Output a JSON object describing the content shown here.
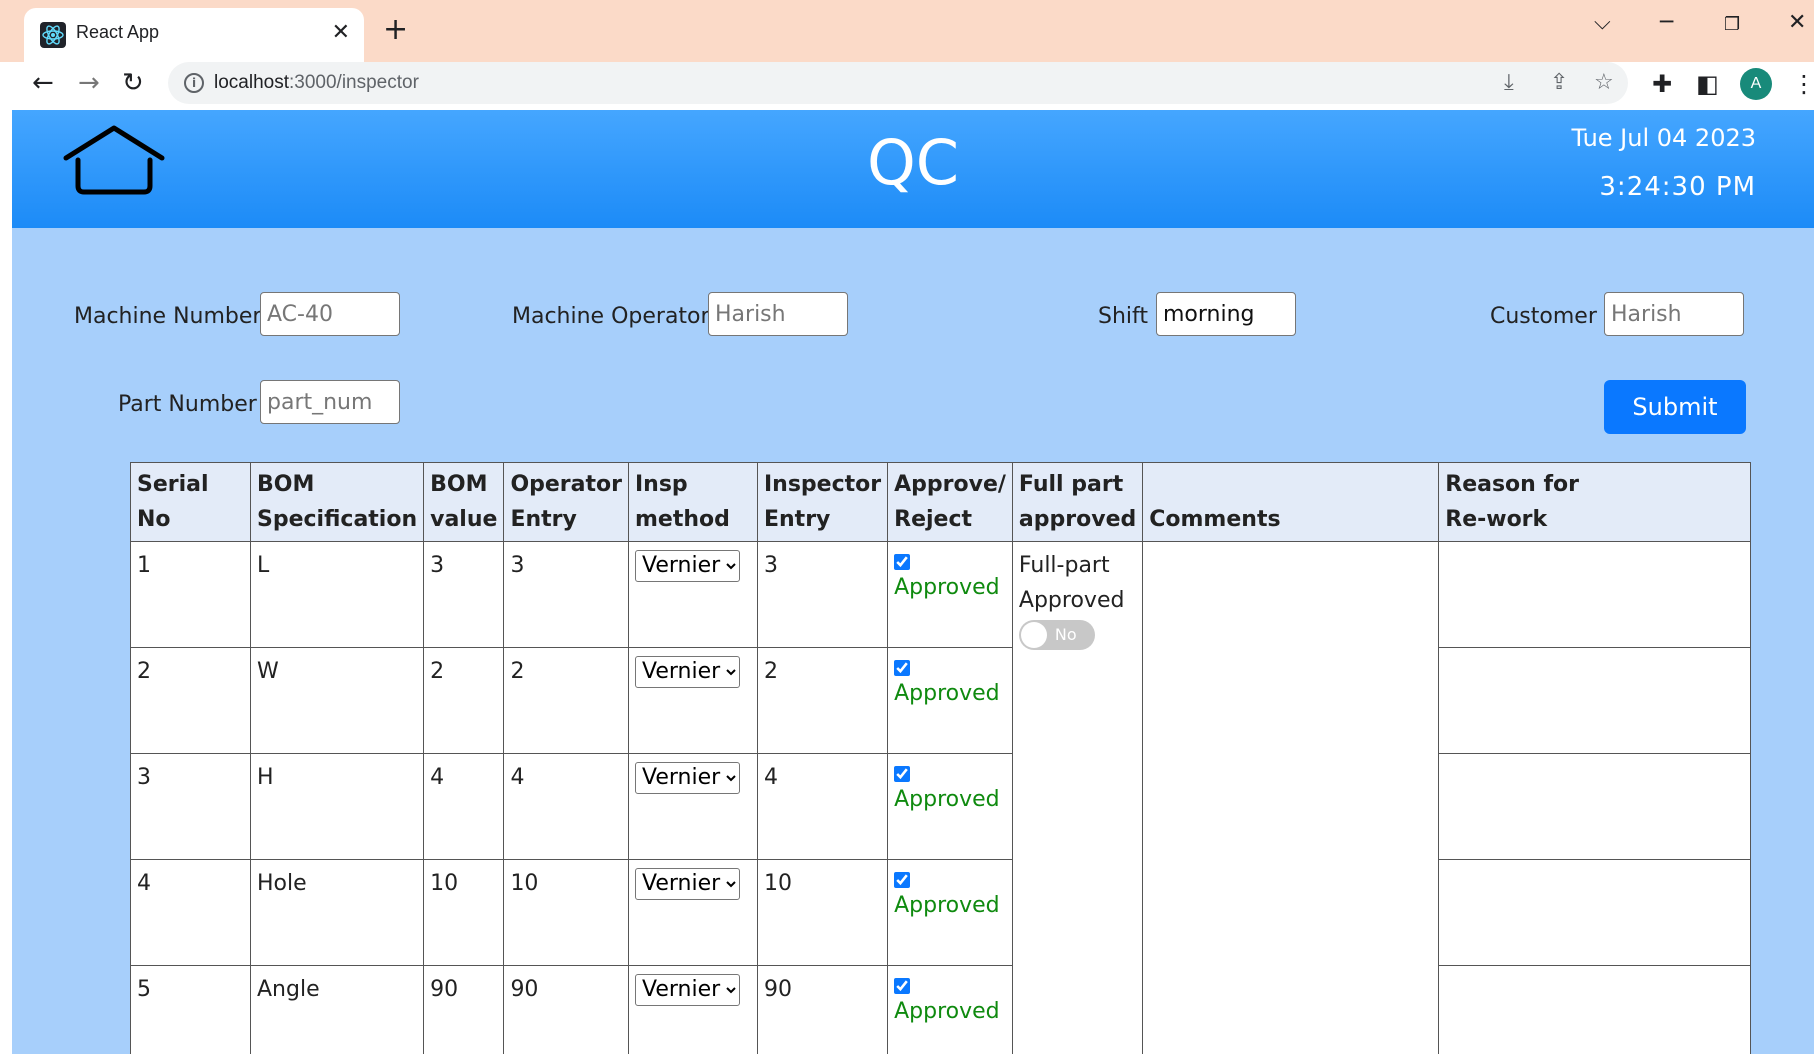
{
  "browser": {
    "tab_title": "React App",
    "url_host": "localhost",
    "url_rest": ":3000/inspector",
    "avatar_letter": "A"
  },
  "header": {
    "title": "QC",
    "date": "Tue Jul 04 2023",
    "time": "3:24:30 PM"
  },
  "form": {
    "machine_number": {
      "label": "Machine Number",
      "placeholder": "AC-40"
    },
    "machine_operator": {
      "label": "Machine Operator",
      "placeholder": "Harish"
    },
    "shift": {
      "label": "Shift",
      "value": "morning"
    },
    "customer": {
      "label": "Customer",
      "placeholder": "Harish"
    },
    "part_number": {
      "label": "Part Number",
      "placeholder": "part_num"
    },
    "submit_label": "Submit"
  },
  "table": {
    "headers": {
      "serial": [
        "Serial No"
      ],
      "bom_spec": [
        "BOM",
        "Specification"
      ],
      "bom_value": [
        "BOM",
        "value"
      ],
      "operator_entry": [
        "Operator",
        "Entry"
      ],
      "insp_method": [
        "Insp",
        "method"
      ],
      "inspector_entry": [
        "Inspector",
        "Entry"
      ],
      "approve_reject": [
        "Approve/",
        "Reject"
      ],
      "full_part": [
        "Full part",
        "approved"
      ],
      "comments": [
        "Comments"
      ],
      "reason": [
        "Reason for",
        "Re-work"
      ]
    },
    "rows": [
      {
        "serial": "1",
        "spec": "L",
        "bom_value": "3",
        "operator_entry": "3",
        "method": "Vernier",
        "inspector_entry": "3",
        "status": "Approved"
      },
      {
        "serial": "2",
        "spec": "W",
        "bom_value": "2",
        "operator_entry": "2",
        "method": "Vernier",
        "inspector_entry": "2",
        "status": "Approved"
      },
      {
        "serial": "3",
        "spec": "H",
        "bom_value": "4",
        "operator_entry": "4",
        "method": "Vernier",
        "inspector_entry": "4",
        "status": "Approved"
      },
      {
        "serial": "4",
        "spec": "Hole",
        "bom_value": "10",
        "operator_entry": "10",
        "method": "Vernier",
        "inspector_entry": "10",
        "status": "Approved"
      },
      {
        "serial": "5",
        "spec": "Angle",
        "bom_value": "90",
        "operator_entry": "90",
        "method": "Vernier",
        "inspector_entry": "90",
        "status": "Approved"
      }
    ],
    "full_part_status": [
      "Full-part",
      "Approved"
    ],
    "toggle_label": "No"
  },
  "colors": {
    "header_blue": "#1c8bf7",
    "page_bg": "#a7cffb",
    "approved_green": "#0f8a0f",
    "submit_blue": "#0a78ff"
  }
}
